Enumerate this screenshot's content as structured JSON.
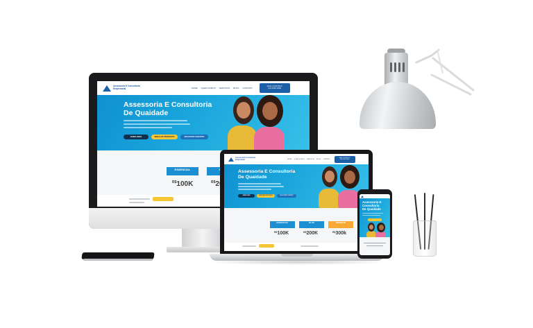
{
  "site": {
    "logo_line1": "Assessoria E Consultoria",
    "logo_line2": "Empresarial",
    "nav": [
      "HOME",
      "QUEM SOMOS",
      "SERVIÇOS",
      "BLOG",
      "CONTATO"
    ],
    "nav_cta_line1": "FALE CONOSCO",
    "nav_cta_line2": "(11) 0000-0000",
    "hero_title_line1": "Assessoria E Consultoria",
    "hero_title_line2": "De Quaidade",
    "buttons": [
      "SAIBA MAIS",
      "SIMULAR PROPOSTA",
      "SOLICITAR CONTATO"
    ],
    "plans": [
      {
        "name": "ESSENCIAL",
        "price": "100K",
        "currency": "R$"
      },
      {
        "name": "PLUS",
        "price": "200K",
        "currency": "R$"
      },
      {
        "name": "PREMIUM",
        "price": "300k",
        "currency": "R$"
      }
    ]
  },
  "phone_site": {
    "hero_title_line1": "Assessoria E",
    "hero_title_line2": "Consultoria",
    "hero_title_line3": "De Quaidade"
  },
  "colors": {
    "brand_blue": "#1b5fa8",
    "hero_cyan": "#1aa6dc",
    "accent_yellow": "#f7c634",
    "dark_button": "#10304f"
  },
  "icons": [
    "lamp-icon",
    "logo-triangle-icon",
    "phone-headset-icon"
  ]
}
